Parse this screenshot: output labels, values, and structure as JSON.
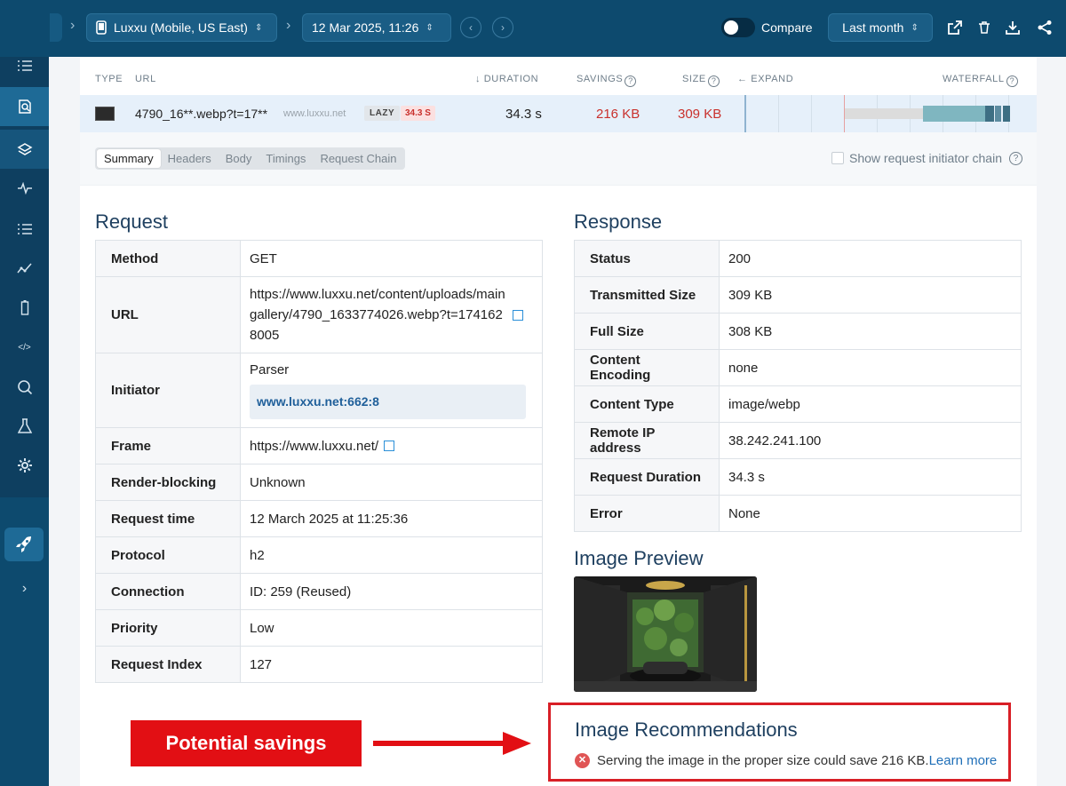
{
  "topbar": {
    "device_label": "Luxxu (Mobile, US East)",
    "datetime_label": "12 Mar 2025, 11:26",
    "compare_label": "Compare",
    "range_label": "Last month"
  },
  "columns": {
    "type": "TYPE",
    "url": "URL",
    "duration": "↓ DURATION",
    "savings": "SAVINGS",
    "size": "SIZE",
    "expand": "← EXPAND",
    "waterfall": "WATERFALL"
  },
  "request_row": {
    "url_short": "4790_16**.webp?t=17**",
    "domain": "www.luxxu.net",
    "lazy_badge": "LAZY",
    "duration_badge": "34.3 S",
    "duration": "34.3 s",
    "savings": "216 KB",
    "size": "309 KB"
  },
  "tabs": [
    "Summary",
    "Headers",
    "Body",
    "Timings",
    "Request Chain"
  ],
  "chain_label": "Show request initiator chain",
  "request": {
    "title": "Request",
    "method_k": "Method",
    "method_v": "GET",
    "url_k": "URL",
    "url_v": "https://www.luxxu.net/content/uploads/maingallery/4790_1633774026.webp?t=1741628005",
    "initiator_k": "Initiator",
    "initiator_v": "Parser",
    "initiator_link": "www.luxxu.net:662:8",
    "frame_k": "Frame",
    "frame_v": "https://www.luxxu.net/",
    "render_k": "Render-blocking",
    "render_v": "Unknown",
    "time_k": "Request time",
    "time_v": "12 March 2025 at 11:25:36",
    "protocol_k": "Protocol",
    "protocol_v": "h2",
    "conn_k": "Connection",
    "conn_v": "ID: 259 (Reused)",
    "priority_k": "Priority",
    "priority_v": "Low",
    "index_k": "Request Index",
    "index_v": "127"
  },
  "response": {
    "title": "Response",
    "status_k": "Status",
    "status_v": "200",
    "tsize_k": "Transmitted Size",
    "tsize_v": "309 KB",
    "fsize_k": "Full Size",
    "fsize_v": "308 KB",
    "enc_k": "Content Encoding",
    "enc_v": "none",
    "ctype_k": "Content Type",
    "ctype_v": "image/webp",
    "ip_k": "Remote IP address",
    "ip_v": "38.242.241.100",
    "dur_k": "Request Duration",
    "dur_v": "34.3 s",
    "err_k": "Error",
    "err_v": "None"
  },
  "preview_title": "Image Preview",
  "recommendations": {
    "title": "Image Recommendations",
    "text": "Serving the image in the proper size could save 216 KB.",
    "link": "Learn more"
  },
  "callout": "Potential savings",
  "colors": {
    "accent": "#0d4a6e",
    "savings_red": "#c9302c",
    "annotation_red": "#e20f14"
  }
}
